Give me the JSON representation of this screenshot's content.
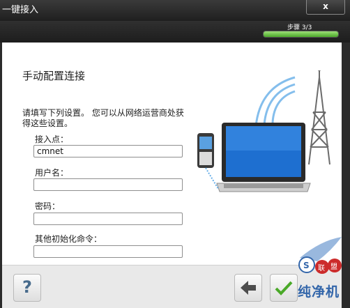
{
  "window": {
    "title": "一键接入",
    "close_symbol": "x"
  },
  "step": {
    "label": "步骤 3/3",
    "progress": 1.0
  },
  "page": {
    "title": "手动配置连接",
    "instruction": "请填写下列设置。 您可以从网络运营商处获得这些设置。"
  },
  "fields": {
    "apn": {
      "label": "接入点：",
      "value": "cmnet"
    },
    "username": {
      "label": "用户名：",
      "value": ""
    },
    "password": {
      "label": "密码：",
      "value": ""
    },
    "init_command": {
      "label": "其他初始化命令：",
      "value": ""
    }
  },
  "toolbar": {
    "help_label": "?",
    "back_icon": "arrow-left-icon",
    "finish_icon": "checkmark-icon"
  },
  "watermark": {
    "text": "纯净机",
    "badge_letters": [
      "S",
      "联",
      "盟"
    ]
  },
  "colors": {
    "progress": "#4aa928",
    "screen_blue": "#1e6fd0",
    "signal_blue": "#66aee8"
  }
}
